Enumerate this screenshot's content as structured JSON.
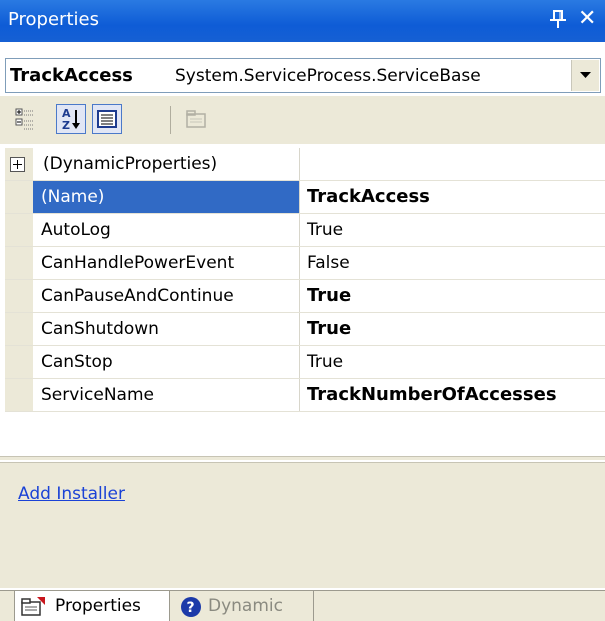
{
  "window": {
    "title": "Properties",
    "pin_icon": "pushpin-icon",
    "close_icon": "close-icon",
    "title_bar_color": "#0e5cd6"
  },
  "object_selector": {
    "name": "TrackAccess",
    "type": "System.ServiceProcess.ServiceBase",
    "dropdown_icon": "chevron-down-icon"
  },
  "toolbar": {
    "buttons": [
      {
        "name": "categorized-button",
        "icon": "categorized-icon",
        "active": false
      },
      {
        "name": "alphabetical-button",
        "icon": "sort-alphabetical-icon",
        "active": true
      },
      {
        "name": "properties-view-button",
        "icon": "properties-list-icon",
        "active": true
      },
      {
        "name": "property-pages-button",
        "icon": "property-pages-icon",
        "active": false,
        "disabled": true
      }
    ]
  },
  "grid": {
    "rows": [
      {
        "name": "(DynamicProperties)",
        "value": "",
        "bold": false,
        "expandable": true,
        "selected": false
      },
      {
        "name": "(Name)",
        "value": "TrackAccess",
        "bold": true,
        "expandable": false,
        "selected": true
      },
      {
        "name": "AutoLog",
        "value": "True",
        "bold": false,
        "expandable": false,
        "selected": false
      },
      {
        "name": "CanHandlePowerEvent",
        "value": "False",
        "bold": false,
        "expandable": false,
        "selected": false
      },
      {
        "name": "CanPauseAndContinue",
        "value": "True",
        "bold": true,
        "expandable": false,
        "selected": false
      },
      {
        "name": "CanShutdown",
        "value": "True",
        "bold": true,
        "expandable": false,
        "selected": false
      },
      {
        "name": "CanStop",
        "value": "True",
        "bold": false,
        "expandable": false,
        "selected": false
      },
      {
        "name": "ServiceName",
        "value": "TrackNumberOfAccesses",
        "bold": true,
        "expandable": false,
        "selected": false
      }
    ],
    "selection_color": "#316ac5"
  },
  "commands": {
    "add_installer": "Add Installer",
    "link_color": "#1a42d6"
  },
  "tabs": [
    {
      "label": "Properties",
      "icon": "properties-icon",
      "active": true
    },
    {
      "label": "Dynamic Help",
      "icon": "help-icon",
      "active": false
    }
  ]
}
